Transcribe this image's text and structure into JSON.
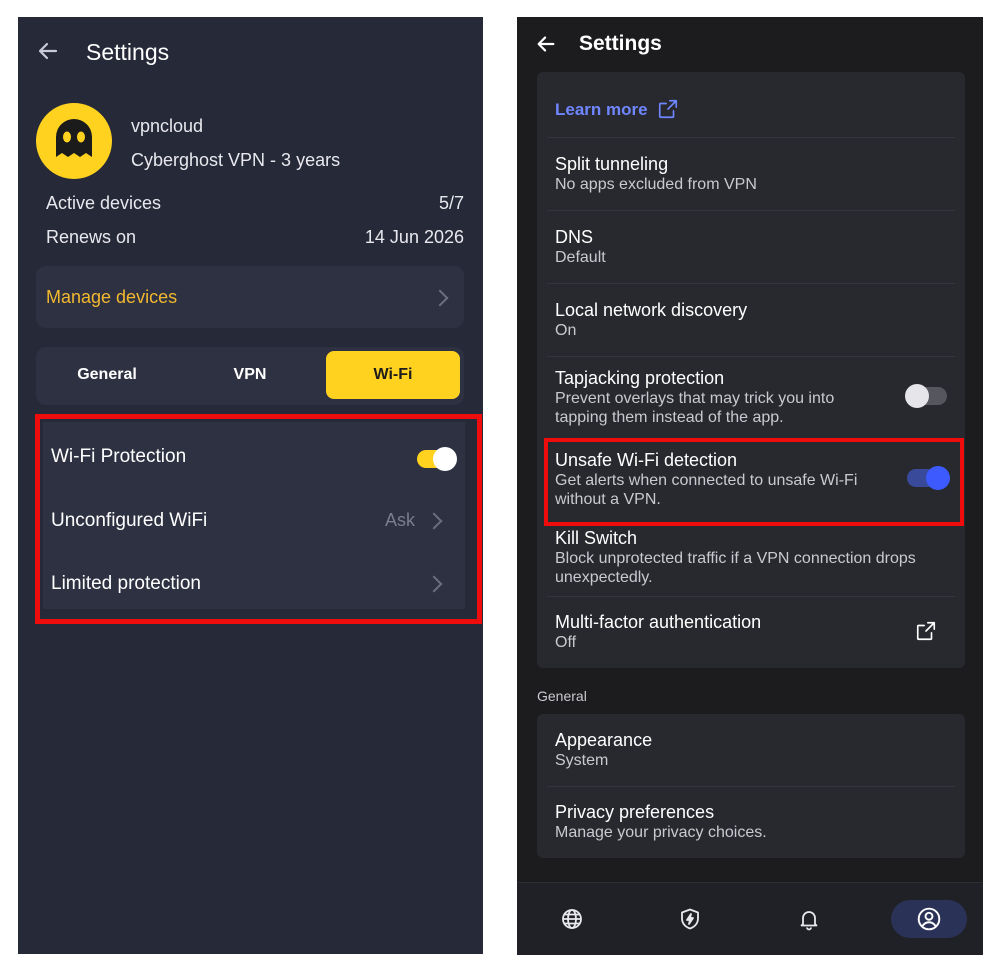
{
  "left": {
    "title": "Settings",
    "account": {
      "name": "vpncloud",
      "plan": "Cyberghost VPN - 3 years"
    },
    "details": [
      {
        "label": "Active devices",
        "value": "5/7"
      },
      {
        "label": "Renews on",
        "value": "14 Jun 2026"
      }
    ],
    "manage_devices": "Manage devices",
    "tabs": [
      {
        "label": "General"
      },
      {
        "label": "VPN"
      },
      {
        "label": "Wi-Fi"
      }
    ],
    "active_tab": "Wi-Fi",
    "wifi": {
      "protection": {
        "label": "Wi-Fi Protection",
        "on": true
      },
      "unconfigured": {
        "label": "Unconfigured WiFi",
        "value": "Ask"
      },
      "limited": {
        "label": "Limited protection"
      }
    },
    "colors": {
      "bg": "#262938",
      "accent": "#ffd21f",
      "manage": "#f2b92f"
    }
  },
  "right": {
    "title": "Settings",
    "learn_more": "Learn more",
    "items": [
      {
        "title": "Split tunneling",
        "subtitle": "No apps excluded from VPN"
      },
      {
        "title": "DNS",
        "subtitle": "Default"
      },
      {
        "title": "Local network discovery",
        "subtitle": "On"
      },
      {
        "title": "Tapjacking protection",
        "subtitle": "Prevent overlays that may trick you into tapping them instead of the app.",
        "toggle": false
      },
      {
        "title": "Unsafe Wi-Fi detection",
        "subtitle": "Get alerts when connected to unsafe Wi-Fi without a VPN.",
        "toggle": true
      },
      {
        "title": "Kill Switch",
        "subtitle": "Block unprotected traffic if a VPN connection drops unexpectedly."
      },
      {
        "title": "Multi-factor authentication",
        "subtitle": "Off",
        "icon": "external-link-icon"
      }
    ],
    "section_general": "General",
    "general_items": [
      {
        "title": "Appearance",
        "subtitle": "System"
      },
      {
        "title": "Privacy preferences",
        "subtitle": "Manage your privacy choices."
      }
    ],
    "nav": [
      {
        "icon": "globe-icon"
      },
      {
        "icon": "shield-bolt-icon"
      },
      {
        "icon": "bell-icon"
      },
      {
        "icon": "account-icon",
        "active": true
      }
    ],
    "colors": {
      "bg": "#1c1c1f",
      "card": "#28292f",
      "accent": "#3d5afe",
      "link": "#6f86ff"
    }
  }
}
